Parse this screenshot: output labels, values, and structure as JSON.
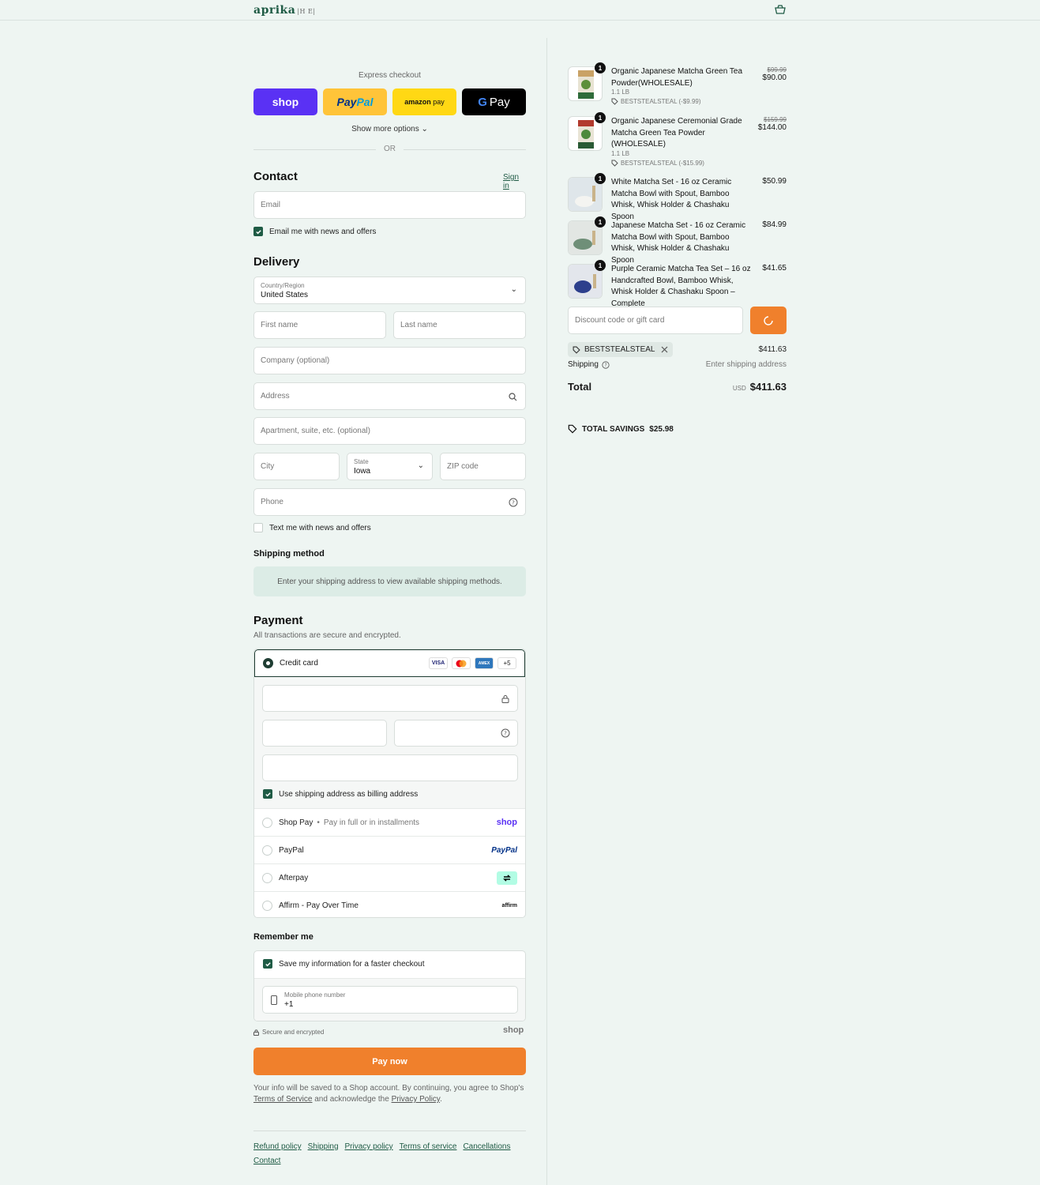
{
  "header": {
    "logo": "aprika",
    "logo_sub": "|H E|"
  },
  "express": {
    "title": "Express checkout",
    "buttons": {
      "shop": "shop",
      "paypal_a": "Pay",
      "paypal_b": "Pal",
      "amazon": "amazon",
      "amazon_pay": "pay",
      "gpay_g": "G",
      "gpay": "Pay"
    },
    "show_more": "Show more options",
    "or": "OR"
  },
  "contact": {
    "title": "Contact",
    "signin": "Sign in",
    "email_placeholder": "Email",
    "news_label": "Email me with news and offers"
  },
  "delivery": {
    "title": "Delivery",
    "country_label": "Country/Region",
    "country_value": "United States",
    "first_name": "First name",
    "last_name": "Last name",
    "company": "Company (optional)",
    "address": "Address",
    "apartment": "Apartment, suite, etc. (optional)",
    "city": "City",
    "state_label": "State",
    "state_value": "Iowa",
    "zip": "ZIP code",
    "phone": "Phone",
    "text_label": "Text me with news and offers"
  },
  "shipping_method": {
    "title": "Shipping method",
    "message": "Enter your shipping address to view available shipping methods."
  },
  "payment": {
    "title": "Payment",
    "subtitle": "All transactions are secure and encrypted.",
    "credit_card": "Credit card",
    "card_badges": {
      "visa": "VISA",
      "amex": "AMEX",
      "more": "+5"
    },
    "billing_label": "Use shipping address as billing address",
    "shop_pay": "Shop Pay",
    "shop_pay_sub": "Pay in full or in installments",
    "shop_logo": "shop",
    "paypal": "PayPal",
    "paypal_logo": "PayPal",
    "afterpay": "Afterpay",
    "affirm": "Affirm - Pay Over Time",
    "affirm_logo": "affirm"
  },
  "remember": {
    "title": "Remember me",
    "save_label": "Save my information for a faster checkout",
    "phone_label": "Mobile phone number",
    "phone_value": "+1",
    "secure": "Secure and encrypted",
    "shop_logo": "shop"
  },
  "pay_now": "Pay now",
  "legal": {
    "text1": "Your info will be saved to a Shop account. By continuing, you agree to Shop's",
    "tos": "Terms of Service",
    "text2": "and acknowledge the",
    "privacy": "Privacy Policy",
    "end": "."
  },
  "footer": [
    "Refund policy",
    "Shipping",
    "Privacy policy",
    "Terms of service",
    "Cancellations",
    "Contact"
  ],
  "order": {
    "items": [
      {
        "qty": "1",
        "name": "Organic Japanese Matcha Green Tea Powder(WHOLESALE)",
        "old_price": "$99.99",
        "price": "$90.00",
        "variant": "1.1 LB",
        "discount": "BESTSTEALSTEAL (-$9.99)"
      },
      {
        "qty": "1",
        "name": "Organic Japanese Ceremonial Grade Matcha Green Tea Powder (WHOLESALE)",
        "old_price": "$159.99",
        "price": "$144.00",
        "variant": "1.1 LB",
        "discount": "BESTSTEALSTEAL (-$15.99)"
      },
      {
        "qty": "1",
        "name": "White Matcha Set - 16 oz Ceramic Matcha Bowl with Spout, Bamboo Whisk, Whisk Holder & Chashaku Spoon",
        "price": "$50.99"
      },
      {
        "qty": "1",
        "name": "Japanese Matcha Set - 16 oz Ceramic Matcha Bowl with Spout, Bamboo Whisk, Whisk Holder & Chashaku Spoon",
        "price": "$84.99"
      },
      {
        "qty": "1",
        "name": "Purple Ceramic Matcha Tea Set – 16 oz Handcrafted Bowl, Bamboo Whisk, Whisk Holder & Chashaku Spoon – Complete",
        "price": "$41.65"
      }
    ],
    "discount_placeholder": "Discount code or gift card",
    "applied_code": "BESTSTEALSTEAL",
    "subtotal": "$411.63",
    "shipping_label": "Shipping",
    "shipping_value": "Enter shipping address",
    "total_label": "Total",
    "currency": "USD",
    "total": "$411.63",
    "savings_label": "TOTAL SAVINGS",
    "savings": "$25.98"
  },
  "colors": {
    "accent": "#1f5b45",
    "orange": "#f0802c",
    "shop_purple": "#5a31f4",
    "paypal_yellow": "#ffc439",
    "amazon_yellow": "#ffd814"
  }
}
